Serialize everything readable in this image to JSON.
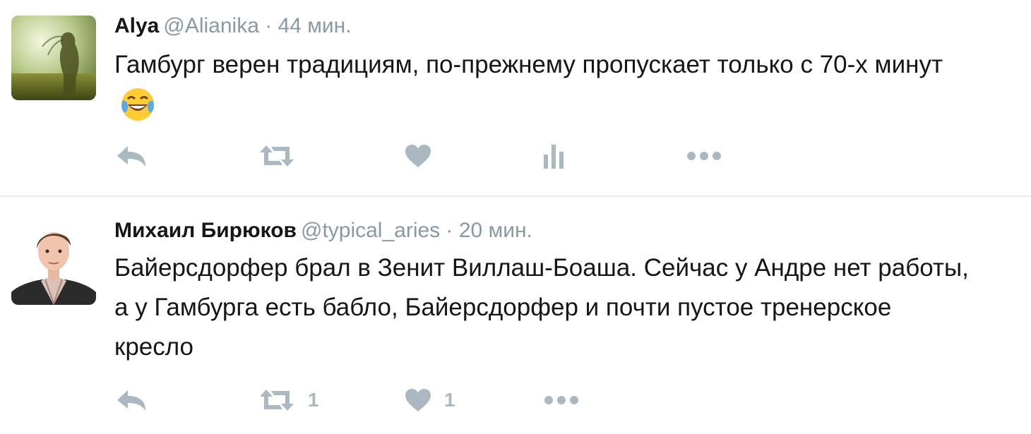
{
  "colors": {
    "text": "#14171a",
    "secondary": "#8899a6",
    "action_icon": "#aab8c2",
    "divider": "#e6ecf0"
  },
  "tweets": [
    {
      "fullname": "Alya",
      "username": "@Alianika",
      "separator": "·",
      "time": "44 мин.",
      "text": "Гамбург верен традициям, по-прежнему пропускает только с 70-х минут",
      "emoji": "face-with-tears-of-joy",
      "actions": {
        "reply": {
          "icon": "reply-icon",
          "count": ""
        },
        "retweet": {
          "icon": "retweet-icon",
          "count": ""
        },
        "like": {
          "icon": "heart-icon",
          "count": ""
        },
        "analytics": {
          "icon": "analytics-icon",
          "count": ""
        },
        "more": {
          "icon": "more-icon"
        }
      }
    },
    {
      "fullname": "Михаил Бирюков",
      "username": "@typical_aries",
      "separator": "·",
      "time": "20 мин.",
      "text": "Байерсдорфер брал в Зенит Виллаш-Боаша. Сейчас у Андре нет работы, а у Гамбурга есть бабло, Байерсдорфер и почти пустое тренерское кресло",
      "actions": {
        "reply": {
          "icon": "reply-icon",
          "count": ""
        },
        "retweet": {
          "icon": "retweet-icon",
          "count": "1"
        },
        "like": {
          "icon": "heart-icon",
          "count": "1"
        },
        "more": {
          "icon": "more-icon"
        }
      }
    }
  ]
}
